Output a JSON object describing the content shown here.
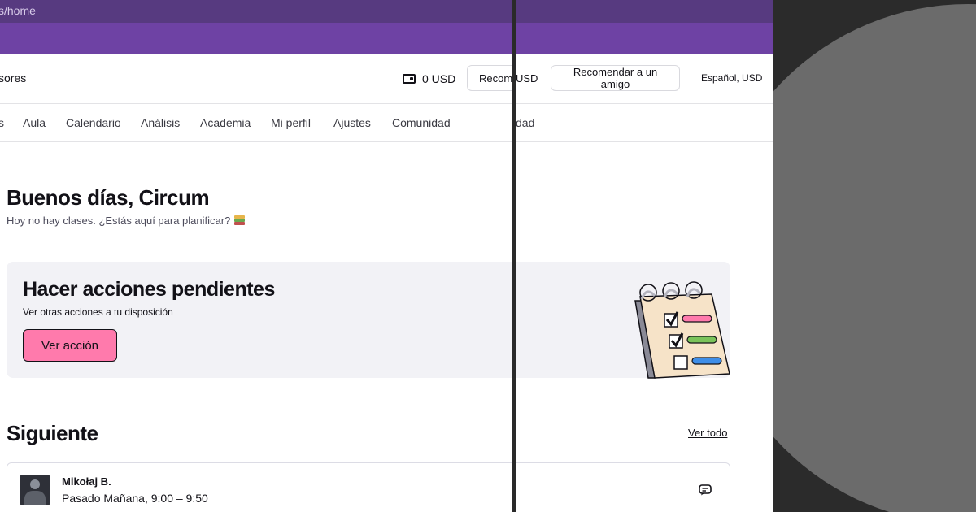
{
  "browser": {
    "url_fragment": "s/home"
  },
  "header": {
    "left_label": "sores",
    "wallet_balance": "0 USD",
    "refer_button_partial": "Recome",
    "currency_partial": "USD",
    "refer_button": "Recomendar a un amigo",
    "language_currency": "Español, USD"
  },
  "nav": {
    "items": [
      {
        "label": "s"
      },
      {
        "label": "Aula"
      },
      {
        "label": "Calendario"
      },
      {
        "label": "Análisis"
      },
      {
        "label": "Academia"
      },
      {
        "label": "Mi perfil"
      },
      {
        "label": "Ajustes"
      },
      {
        "label": "Comunidad"
      }
    ],
    "partial_right": "dad"
  },
  "greeting": {
    "title": "Buenos días, Circum",
    "subtitle": "Hoy no hay clases. ¿Estás aquí para planificar?"
  },
  "pending_card": {
    "title": "Hacer acciones pendientes",
    "subtitle": "Ver otras acciones a tu disposición",
    "button": "Ver acción"
  },
  "next_section": {
    "title": "Siguiente",
    "see_all": "Ver todo",
    "lesson": {
      "name": "Mikołaj B.",
      "time": "Pasado Mañana, 9:00 – 9:50"
    }
  },
  "icons": {
    "wallet": "wallet-icon",
    "books": "books-icon",
    "illustration": "checklist-illustration",
    "chat": "chat-icon"
  },
  "colors": {
    "browser_bar": "#573a80",
    "brand_purple": "#6e42a4",
    "action_pink": "#ff7aac",
    "card_bg": "#f2f2f6"
  }
}
